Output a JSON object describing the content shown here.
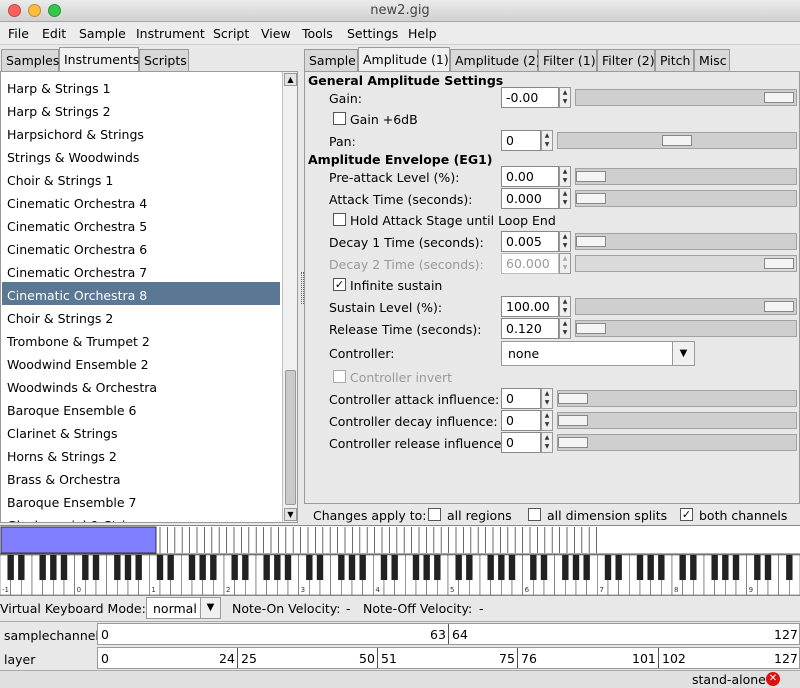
{
  "window": {
    "title": "new2.gig"
  },
  "menu": [
    "File",
    "Edit",
    "Sample",
    "Instrument",
    "Script",
    "View",
    "Tools",
    "Settings",
    "Help"
  ],
  "left_tabs": [
    "Samples",
    "Instruments",
    "Scripts"
  ],
  "instruments": [
    "Harp & Strings 1",
    "Harp & Strings 2",
    "Harpsichord & Strings",
    "Strings & Woodwinds",
    "Choir & Strings 1",
    "Cinematic Orchestra 4",
    "Cinematic Orchestra 5",
    "Cinematic Orchestra 6",
    "Cinematic Orchestra 7",
    "Cinematic Orchestra 8",
    "Choir & Strings 2",
    "Trombone & Trumpet 2",
    "Woodwind Ensemble 2",
    "Woodwinds & Orchestra",
    "Baroque Ensemble 6",
    "Clarinet & Strings",
    "Horns & Strings 2",
    "Brass & Orchestra",
    "Baroque Ensemble 7",
    "Glockenspiel & Strings"
  ],
  "selected_instrument": "Cinematic Orchestra 8",
  "right_tabs": [
    "Sample",
    "Amplitude (1)",
    "Amplitude (2)",
    "Filter (1)",
    "Filter (2)",
    "Pitch",
    "Misc"
  ],
  "amp": {
    "general_header": "General Amplitude Settings",
    "gain_label": "Gain:",
    "gain_value": "-0.00",
    "gain6_label": "Gain +6dB",
    "pan_label": "Pan:",
    "pan_value": "0",
    "env_header": "Amplitude Envelope (EG1)",
    "preattack_label": "Pre-attack Level (%):",
    "preattack_value": "0.00",
    "attack_label": "Attack Time (seconds):",
    "attack_value": "0.000",
    "hold_label": "Hold Attack Stage until Loop End",
    "decay1_label": "Decay 1 Time (seconds):",
    "decay1_value": "0.005",
    "decay2_label": "Decay 2 Time (seconds):",
    "decay2_value": "60.000",
    "infinite_label": "Infinite sustain",
    "sustain_label": "Sustain Level (%):",
    "sustain_value": "100.00",
    "release_label": "Release Time (seconds):",
    "release_value": "0.120",
    "controller_label": "Controller:",
    "controller_value": "none",
    "ctrl_invert_label": "Controller invert",
    "ctrl_attack_label": "Controller attack influence:",
    "ctrl_attack_value": "0",
    "ctrl_decay_label": "Controller decay influence:",
    "ctrl_decay_value": "0",
    "ctrl_release_label": "Controller release influence:",
    "ctrl_release_value": "0"
  },
  "changes": {
    "label": "Changes apply to:",
    "all_regions": "all regions",
    "all_dims": "all dimension splits",
    "both_channels": "both channels"
  },
  "vk": {
    "mode_label": "Virtual Keyboard Mode:",
    "mode_value": "normal",
    "noteon_label": "Note-On Velocity:",
    "noteon_value": "-",
    "noteoff_label": "Note-Off Velocity:",
    "noteoff_value": "-"
  },
  "octaves": [
    "-1",
    "0",
    "1",
    "2",
    "3",
    "4",
    "5",
    "6",
    "7",
    "8",
    "9"
  ],
  "dims": {
    "samplechannel_label": "samplechannel",
    "samplechannel_values": [
      "0",
      "63",
      "64",
      "127"
    ],
    "layer_label": "layer",
    "layer_values": [
      "0",
      "24",
      "25",
      "50",
      "51",
      "75",
      "76",
      "101",
      "102",
      "127"
    ]
  },
  "status": {
    "mode": "stand-alone"
  },
  "colors": {
    "selection": "#5a7894",
    "keyboard_region": "#7f7fff"
  }
}
